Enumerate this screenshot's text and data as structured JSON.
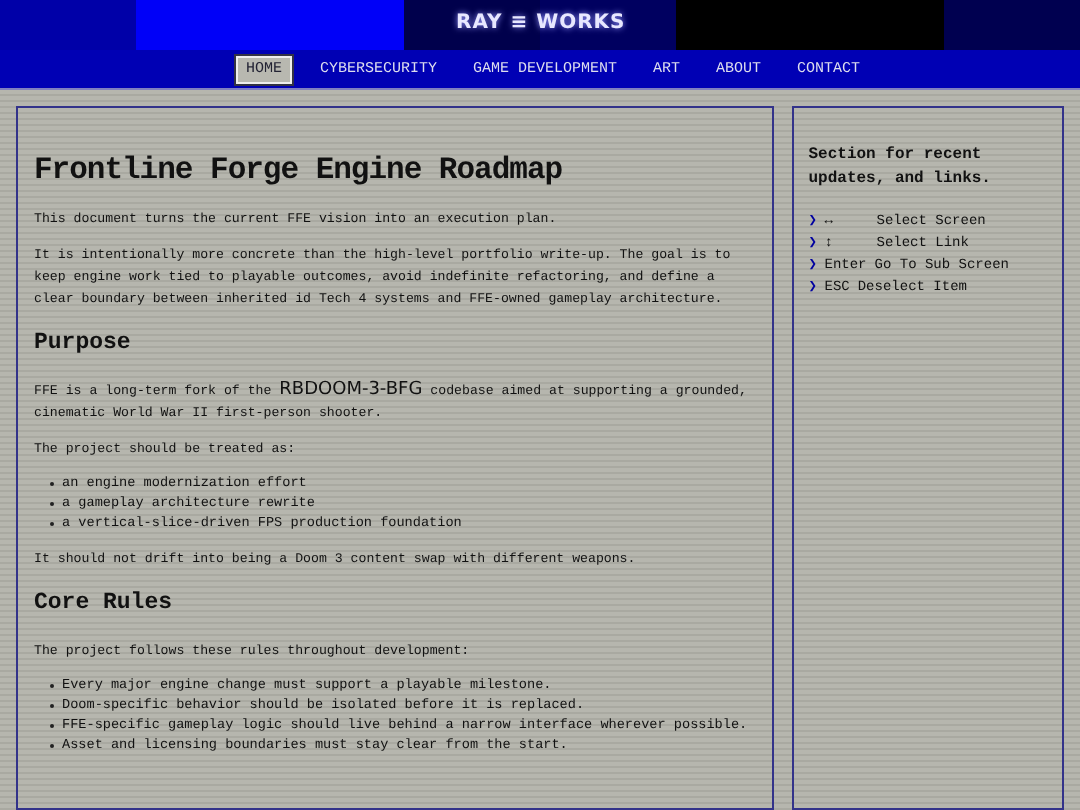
{
  "header": {
    "logo": "RAY ≡ WORKS"
  },
  "nav": [
    {
      "label": "HOME",
      "selected": true
    },
    {
      "label": "CYBERSECURITY",
      "selected": false
    },
    {
      "label": "GAME DEVELOPMENT",
      "selected": false
    },
    {
      "label": "ART",
      "selected": false
    },
    {
      "label": "ABOUT",
      "selected": false
    },
    {
      "label": "CONTACT",
      "selected": false
    }
  ],
  "article": {
    "title": "Frontline Forge Engine Roadmap",
    "blocks": [
      {
        "kind": "p",
        "text": "This document turns the current FFE vision into an execution plan."
      },
      {
        "kind": "p",
        "text": "It is intentionally more concrete than the high-level portfolio write-up. The goal is to keep engine work tied to playable outcomes, avoid indefinite refactoring, and define a clear boundary between inherited id Tech 4 systems and FFE-owned gameplay architecture."
      },
      {
        "kind": "h2",
        "text": "Purpose"
      },
      {
        "kind": "p",
        "text": "FFE is a long-term fork of the ",
        "highlight": "RBDOOM-3-BFG",
        "text_after": " codebase aimed at supporting a grounded, cinematic World War II first-person shooter."
      },
      {
        "kind": "p",
        "text": "The project should be treated as:"
      },
      {
        "kind": "ul",
        "items": [
          "an engine modernization effort",
          "a gameplay architecture rewrite",
          "a vertical-slice-driven FPS production foundation"
        ]
      },
      {
        "kind": "p",
        "text": "It should not drift into being a Doom 3 content swap with different weapons."
      },
      {
        "kind": "h2",
        "text": "Core Rules"
      },
      {
        "kind": "p",
        "text": "The project follows these rules throughout development:"
      },
      {
        "kind": "ul",
        "items": [
          "Every major engine change must support a playable milestone.",
          "Doom-specific behavior should be isolated before it is replaced.",
          "FFE-specific gameplay logic should live behind a narrow interface wherever possible.",
          "Asset and licensing boundaries must stay clear from the start."
        ]
      }
    ]
  },
  "sidebar": {
    "heading": "Section for recent updates, and links.",
    "keys": [
      {
        "marker": "❯",
        "key": "↔",
        "action": "Select Screen"
      },
      {
        "marker": "❯",
        "key": "↕",
        "action": "Select Link"
      },
      {
        "marker": "❯",
        "key": "Enter",
        "action": "Go To Sub Screen"
      },
      {
        "marker": "❯",
        "key": "ESC",
        "action": "Deselect Item"
      }
    ]
  }
}
